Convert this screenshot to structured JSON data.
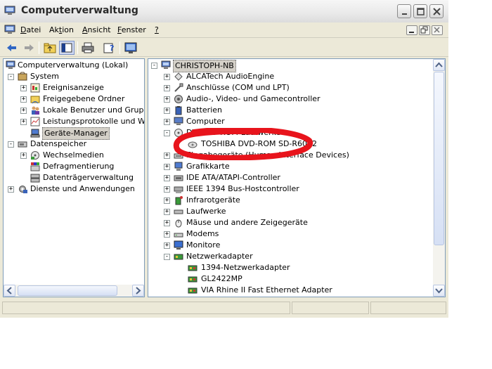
{
  "window": {
    "title": "Computerverwaltung",
    "title_icon": "computer-management-icon"
  },
  "menu": {
    "items": [
      {
        "prefix": "",
        "accel": "D",
        "rest": "atei"
      },
      {
        "prefix": "Ak",
        "accel": "t",
        "rest": "ion"
      },
      {
        "prefix": "",
        "accel": "A",
        "rest": "nsicht"
      },
      {
        "prefix": "",
        "accel": "F",
        "rest": "enster"
      },
      {
        "prefix": "",
        "accel": "?",
        "rest": ""
      }
    ]
  },
  "toolbar": {
    "buttons": [
      "back-arrow-icon",
      "forward-arrow-icon",
      "up-folder-icon",
      "show-hide-tree-icon",
      "print-icon",
      "properties-help-icon",
      "monitor-properties-icon"
    ]
  },
  "left_tree": [
    {
      "label": "Computerverwaltung (Lokal)",
      "icon": "computer-management-icon",
      "expander": ""
    },
    {
      "label": "System",
      "icon": "system-tools-icon",
      "expander": "-"
    },
    {
      "label": "Ereignisanzeige",
      "icon": "event-viewer-icon",
      "expander": "+"
    },
    {
      "label": "Freigegebene Ordner",
      "icon": "shared-folder-icon",
      "expander": "+"
    },
    {
      "label": "Lokale Benutzer und Gruppen",
      "icon": "users-icon",
      "expander": "+"
    },
    {
      "label": "Leistungsprotokolle und Warnungen",
      "icon": "performance-icon",
      "expander": "+"
    },
    {
      "label": "Geräte-Manager",
      "icon": "device-manager-icon",
      "expander": ""
    },
    {
      "label": "Datenspeicher",
      "icon": "storage-icon",
      "expander": "-"
    },
    {
      "label": "Wechselmedien",
      "icon": "removable-media-icon",
      "expander": "+"
    },
    {
      "label": "Defragmentierung",
      "icon": "defrag-icon",
      "expander": ""
    },
    {
      "label": "Datenträgerverwaltung",
      "icon": "disk-management-icon",
      "expander": ""
    },
    {
      "label": "Dienste und Anwendungen",
      "icon": "services-icon",
      "expander": "+"
    }
  ],
  "right_tree": {
    "root": "CHRISTOPH-NB",
    "items": [
      {
        "label": "ALCATech AudioEngine",
        "icon": "audio-engine-icon",
        "expander": "+"
      },
      {
        "label": "Anschlüsse (COM und LPT)",
        "icon": "port-icon",
        "expander": "+"
      },
      {
        "label": "Audio-, Video- und Gamecontroller",
        "icon": "speaker-icon",
        "expander": "+"
      },
      {
        "label": "Batterien",
        "icon": "battery-icon",
        "expander": "+"
      },
      {
        "label": "Computer",
        "icon": "computer-icon",
        "expander": "+"
      },
      {
        "label": "DVD/CD-ROM-Laufwerke",
        "icon": "cdrom-icon",
        "expander": "-"
      },
      {
        "label": "TOSHIBA DVD-ROM SD-R6012",
        "icon": "cd-drive-icon",
        "expander": ""
      },
      {
        "label": "Eingabegeräte (Human Interface Devices)",
        "icon": "hid-icon",
        "expander": "+"
      },
      {
        "label": "Grafikkarte",
        "icon": "display-adapter-icon",
        "expander": "+"
      },
      {
        "label": "IDE ATA/ATAPI-Controller",
        "icon": "ide-controller-icon",
        "expander": "+"
      },
      {
        "label": "IEEE 1394 Bus-Hostcontroller",
        "icon": "firewire-icon",
        "expander": "+"
      },
      {
        "label": "Infrarotgeräte",
        "icon": "infrared-icon",
        "expander": "+"
      },
      {
        "label": "Laufwerke",
        "icon": "disk-drive-icon",
        "expander": "+"
      },
      {
        "label": "Mäuse und andere Zeigegeräte",
        "icon": "mouse-icon",
        "expander": "+"
      },
      {
        "label": "Modems",
        "icon": "modem-icon",
        "expander": "+"
      },
      {
        "label": "Monitore",
        "icon": "monitor-icon",
        "expander": "+"
      },
      {
        "label": "Netzwerkadapter",
        "icon": "network-adapter-icon",
        "expander": "-"
      },
      {
        "label": "1394-Netzwerkadapter",
        "icon": "network-card-icon",
        "expander": ""
      },
      {
        "label": "GL2422MP",
        "icon": "network-card-icon",
        "expander": ""
      },
      {
        "label": "VIA Rhine II Fast Ethernet Adapter",
        "icon": "network-card-icon",
        "expander": ""
      }
    ]
  },
  "annotation": {
    "color": "#e8141c",
    "shape": "hand-drawn-ellipse"
  },
  "colors": {
    "selection": "#d4d0c8",
    "pane_border": "#7f9db9",
    "window_bg": "#ece9d8"
  }
}
